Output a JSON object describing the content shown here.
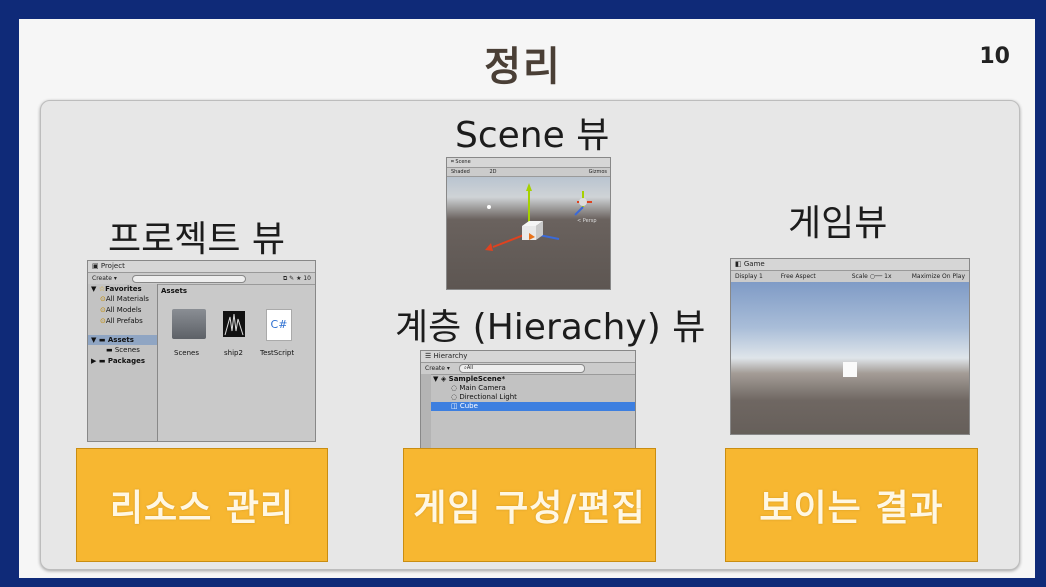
{
  "slide": {
    "title": "정리",
    "page_number": "10"
  },
  "labels": {
    "project_view": "프로젝트 뷰",
    "scene_view": "Scene 뷰",
    "hierarchy_view": "계층 (Hierachy) 뷰",
    "game_view": "게임뷰"
  },
  "boxes": {
    "project": "리소스 관리",
    "hierarchy": "게임 구성/편집",
    "game": "보이는 결과"
  },
  "project_window": {
    "tab": "Project",
    "create": "Create ▾",
    "badge": "10",
    "favorites": "Favorites",
    "favorites_items": [
      "All Materials",
      "All Models",
      "All Prefabs"
    ],
    "assets_header": "Assets",
    "tree_assets": "Assets",
    "tree_scenes": "Scenes",
    "tree_packages": "Packages",
    "files": [
      "Scenes",
      "ship2",
      "TestScript"
    ],
    "csharp": "C#"
  },
  "scene_window": {
    "tab": "Scene",
    "shading": "Shaded",
    "mode": "2D",
    "gizmos": "Gizmos",
    "persp": "< Persp"
  },
  "hierarchy_window": {
    "tab": "Hierarchy",
    "create": "Create ▾",
    "search": "All",
    "scene": "SampleScene*",
    "items": [
      "Main Camera",
      "Directional Light",
      "Cube"
    ]
  },
  "game_window": {
    "tab": "Game",
    "display": "Display 1",
    "aspect": "Free Aspect",
    "scale": "Scale",
    "scale_value": "1x",
    "maximize": "Maximize On Play"
  },
  "colors": {
    "background": "#0f2a78",
    "box": "#f7b731",
    "selection": "#3d7fe0"
  }
}
